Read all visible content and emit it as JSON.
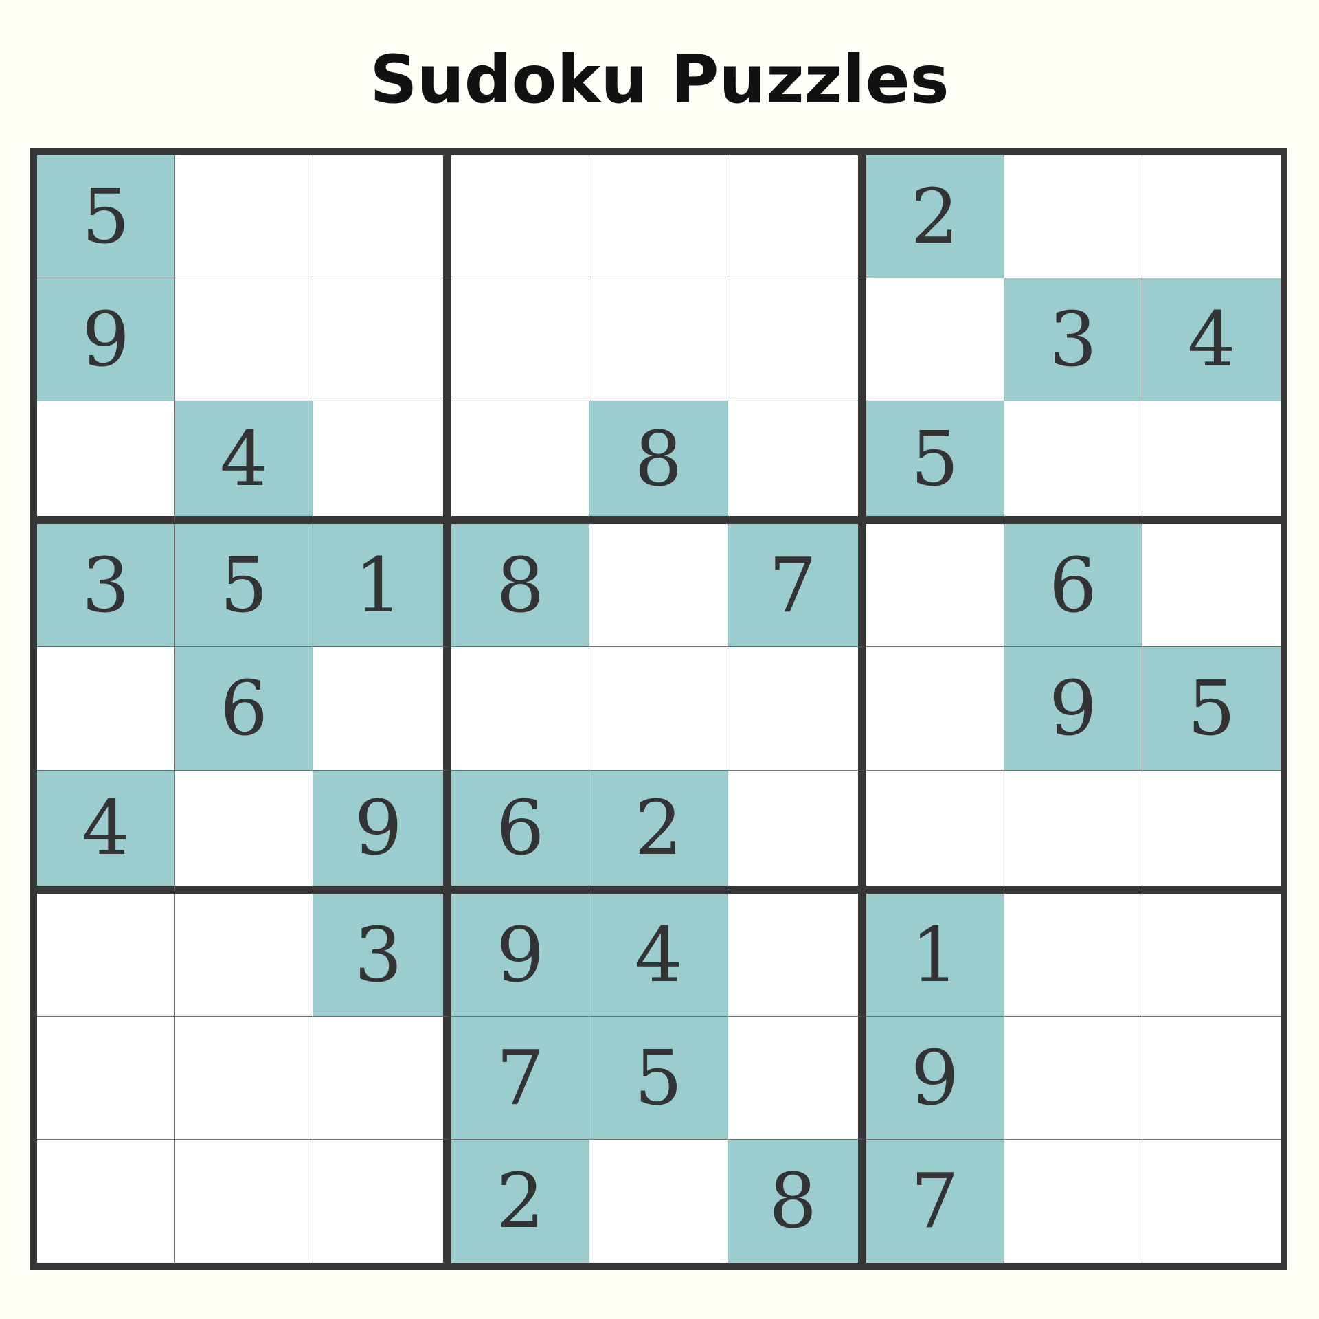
{
  "title": "Sudoku Puzzles",
  "colors": {
    "background": "#fefff6",
    "given_cell": "#9ccdce",
    "grid_line": "#363636",
    "digit": "#333333"
  },
  "grid": [
    [
      "5",
      "",
      "",
      "",
      "",
      "",
      "2",
      "",
      ""
    ],
    [
      "9",
      "",
      "",
      "",
      "",
      "",
      "",
      "3",
      "4"
    ],
    [
      "",
      "4",
      "",
      "",
      "8",
      "",
      "5",
      "",
      ""
    ],
    [
      "3",
      "5",
      "1",
      "8",
      "",
      "7",
      "",
      "6",
      ""
    ],
    [
      "",
      "6",
      "",
      "",
      "",
      "",
      "",
      "9",
      "5"
    ],
    [
      "4",
      "",
      "9",
      "6",
      "2",
      "",
      "",
      "",
      ""
    ],
    [
      "",
      "",
      "3",
      "9",
      "4",
      "",
      "1",
      "",
      ""
    ],
    [
      "",
      "",
      "",
      "7",
      "5",
      "",
      "9",
      "",
      ""
    ],
    [
      "",
      "",
      "",
      "2",
      "",
      "8",
      "7",
      "",
      ""
    ]
  ]
}
